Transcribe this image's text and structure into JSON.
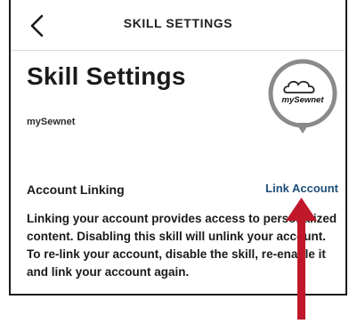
{
  "header": {
    "back_icon": "chevron-left-icon",
    "title": "SKILL SETTINGS"
  },
  "skill": {
    "title": "Skill Settings",
    "developer": "mySewnet",
    "icon_text": "mySewnet",
    "icon_name": "skill-logo-icon"
  },
  "account_linking": {
    "label": "Account Linking",
    "link_label": "Link Account",
    "description": "Linking your account provides access to personalized content. Disabling this skill will unlink your account. To re-link your account, disable the skill, re-enable it and link your account again."
  },
  "annotation": {
    "arrow_color": "#c0182a",
    "arrow_icon": "arrow-up-icon"
  },
  "colors": {
    "link": "#1e4f7a",
    "text": "#1a1a1a",
    "divider": "#d9d9d9"
  }
}
